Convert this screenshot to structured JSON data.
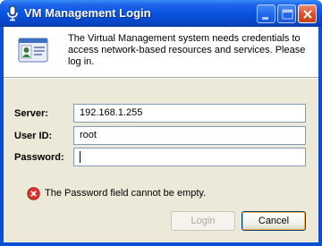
{
  "window": {
    "title": "VM Management Login"
  },
  "titlebar": {
    "icons": [
      "microphone-icon",
      "minimize-icon",
      "maximize-icon",
      "close-icon"
    ]
  },
  "header": {
    "message": "The Virtual Management system needs credentials to access network-based resources and services. Please log in.",
    "icon": "id-card-icon"
  },
  "form": {
    "server_label": "Server:",
    "server_value": "192.168.1.255",
    "userid_label": "User ID:",
    "userid_value": "root",
    "password_label": "Password:",
    "password_value": ""
  },
  "error": {
    "message": "The Password field cannot be empty.",
    "icon": "error-icon",
    "color": "#d9342b"
  },
  "buttons": {
    "login_label": "Login",
    "cancel_label": "Cancel"
  },
  "colors": {
    "titlebar": "#0a53e0",
    "client_bg": "#ece9d8",
    "close_button": "#d9542d"
  }
}
